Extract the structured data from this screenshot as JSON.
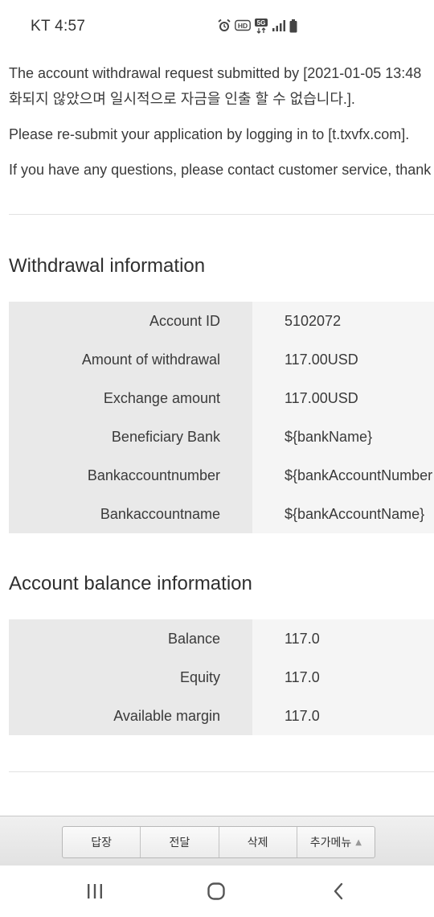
{
  "status_bar": {
    "carrier_time": "KT 4:57",
    "icons": [
      "alarm-icon",
      "hd-icon",
      "5g-icon",
      "signal-icon",
      "battery-icon"
    ]
  },
  "email": {
    "paragraphs": [
      "The account withdrawal request submitted by [2021-01-05 13:48",
      "화되지 않았으며 일시적으로 자금을 인출 할 수 없습니다.].",
      "Please re-submit your application by logging in to [t.txvfx.com].",
      "If you have any questions, please contact customer service, thank"
    ],
    "withdrawal_section": {
      "title": "Withdrawal information",
      "rows": [
        {
          "label": "Account ID",
          "value": "5102072"
        },
        {
          "label": "Amount of withdrawal",
          "value": "117.00USD"
        },
        {
          "label": "Exchange amount",
          "value": "117.00USD"
        },
        {
          "label": "Beneficiary Bank",
          "value": "${bankName}"
        },
        {
          "label": "Bankaccountnumber",
          "value": "${bankAccountNumber"
        },
        {
          "label": "Bankaccountname",
          "value": "${bankAccountName}"
        }
      ]
    },
    "balance_section": {
      "title": "Account balance information",
      "rows": [
        {
          "label": "Balance",
          "value": "117.0"
        },
        {
          "label": "Equity",
          "value": "117.0"
        },
        {
          "label": "Available margin",
          "value": "117.0"
        }
      ]
    }
  },
  "toolbar": {
    "reply": "답장",
    "forward": "전달",
    "delete": "삭제",
    "more": "추가메뉴",
    "more_icon": "caret-up-icon"
  },
  "navigation": {
    "icons": [
      "recents-icon",
      "home-icon",
      "back-icon"
    ]
  },
  "colors": {
    "label_cell_bg": "#e9e9e9",
    "value_cell_bg": "#f5f5f5",
    "toolbar_bg": "#e8e8e8"
  }
}
